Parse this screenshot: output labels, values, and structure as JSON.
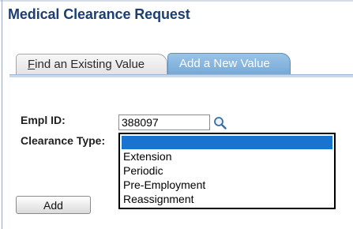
{
  "page": {
    "title": "Medical Clearance Request"
  },
  "tabs": {
    "find": {
      "accesskey": "F",
      "label_rest": "ind an Existing Value"
    },
    "add": {
      "label": "Add a New Value"
    }
  },
  "form": {
    "empl_id": {
      "label": "Empl ID:",
      "value": "388097",
      "lookup_icon": "magnifier-icon"
    },
    "clearance_type": {
      "label": "Clearance Type:",
      "selected": "",
      "options": [
        "Extension",
        "Periodic",
        "Pre-Employment",
        "Reassignment"
      ]
    },
    "add_button": {
      "label": "Add"
    }
  },
  "colors": {
    "title": "#1b3f73",
    "active_tab": "#77a9d6",
    "selection_highlight": "#1a73cf"
  }
}
